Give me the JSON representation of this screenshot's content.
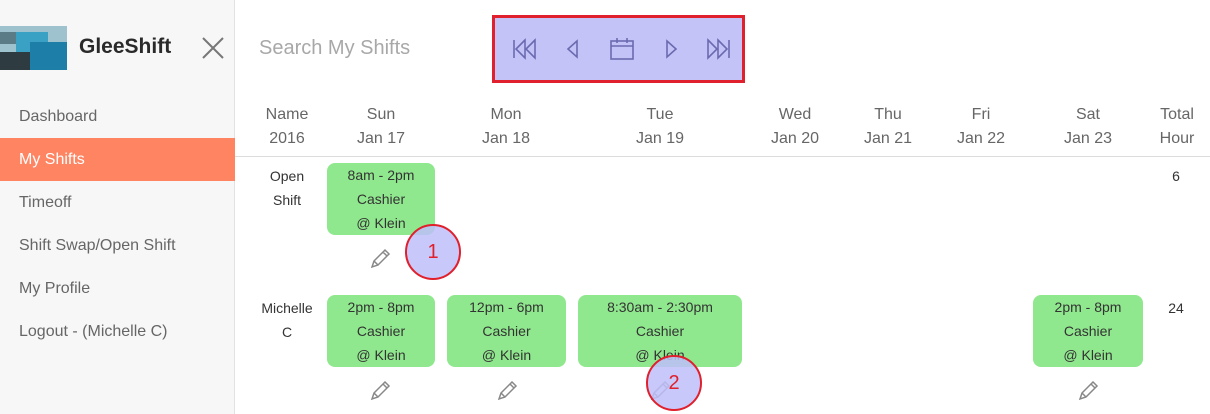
{
  "app": {
    "name": "GleeShift"
  },
  "sidebar": {
    "items": [
      {
        "label": "Dashboard"
      },
      {
        "label": "My Shifts"
      },
      {
        "label": "Timeoff"
      },
      {
        "label": "Shift Swap/Open Shift"
      },
      {
        "label": "My Profile"
      },
      {
        "label": "Logout - (Michelle C)"
      }
    ],
    "active_index": 1
  },
  "search": {
    "placeholder": "Search My Shifts"
  },
  "week_nav": {
    "icons": [
      "skip-back-icon",
      "previous-icon",
      "calendar-icon",
      "next-icon",
      "skip-forward-icon"
    ],
    "highlight_color": "#c4c3f7",
    "border_color": "#e0202c"
  },
  "columns": {
    "name": {
      "line1": "Name",
      "line2": "2016"
    },
    "days": [
      {
        "day": "Sun",
        "date": "Jan 17"
      },
      {
        "day": "Mon",
        "date": "Jan 18"
      },
      {
        "day": "Tue",
        "date": "Jan 19"
      },
      {
        "day": "Wed",
        "date": "Jan 20"
      },
      {
        "day": "Thu",
        "date": "Jan 21"
      },
      {
        "day": "Fri",
        "date": "Jan 22"
      },
      {
        "day": "Sat",
        "date": "Jan 23"
      }
    ],
    "total": {
      "line1": "Total",
      "line2": "Hour"
    }
  },
  "rows": [
    {
      "name_line1": "Open",
      "name_line2": "Shift",
      "total": "6",
      "shifts": [
        {
          "day": "Sun",
          "time": "8am - 2pm",
          "role": "Cashier",
          "location": "@ Klein"
        }
      ]
    },
    {
      "name_line1": "Michelle",
      "name_line2": "C",
      "total": "24",
      "shifts": [
        {
          "day": "Sun",
          "time": "2pm - 8pm",
          "role": "Cashier",
          "location": "@ Klein"
        },
        {
          "day": "Mon",
          "time": "12pm - 6pm",
          "role": "Cashier",
          "location": "@ Klein"
        },
        {
          "day": "Tue",
          "time": "8:30am - 2:30pm",
          "role": "Cashier",
          "location": "@ Klein"
        },
        {
          "day": "Sat",
          "time": "2pm - 8pm",
          "role": "Cashier",
          "location": "@ Klein"
        }
      ]
    }
  ],
  "markers": [
    {
      "label": "1"
    },
    {
      "label": "2"
    }
  ],
  "colors": {
    "accent": "#ff8462",
    "shift": "#90e88e",
    "marker_border": "#e0202c"
  }
}
